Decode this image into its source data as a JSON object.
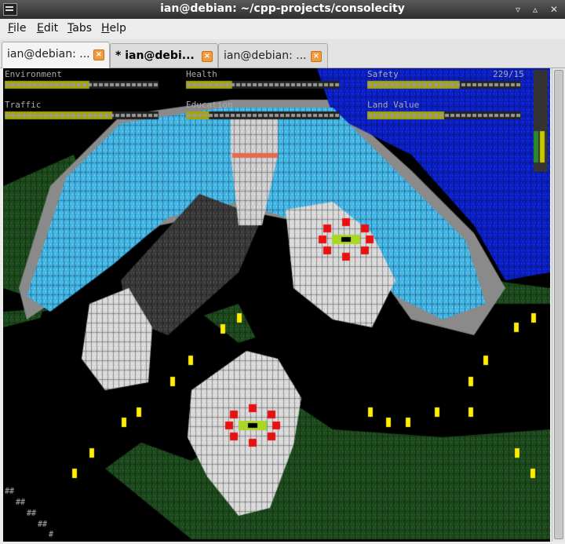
{
  "window": {
    "title": "ian@debian: ~/cpp-projects/consolecity"
  },
  "menu": [
    {
      "label": "File",
      "u": "F",
      "rest": "ile"
    },
    {
      "label": "Edit",
      "u": "E",
      "rest": "dit"
    },
    {
      "label": "Tabs",
      "u": "T",
      "rest": "abs"
    },
    {
      "label": "Help",
      "u": "H",
      "rest": "elp"
    }
  ],
  "tabs": [
    {
      "label": "ian@debian: ...",
      "active": true
    },
    {
      "label": "* ian@debi...",
      "active": false,
      "bold": true
    },
    {
      "label": "ian@debian: ...",
      "active": false
    }
  ],
  "stats": {
    "environment": "Environment",
    "health": "Health",
    "safety": "Safety",
    "traffic": "Traffic",
    "education": "Education",
    "land_value": "Land Value",
    "counter": "229/15"
  },
  "colors": {
    "water": "#3fb6e8",
    "deep_water": "#0a1fc8",
    "grass": "#1d4a1d",
    "building": "#d8d8d8",
    "road": "#000000",
    "bar_fill": "#a6a600",
    "light": "#ffee00"
  }
}
